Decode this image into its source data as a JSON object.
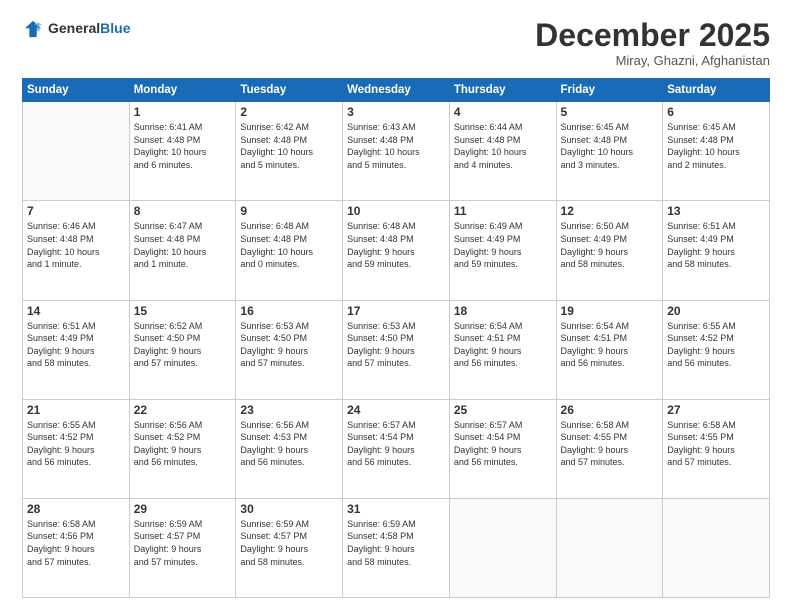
{
  "logo": {
    "general": "General",
    "blue": "Blue"
  },
  "header": {
    "month": "December 2025",
    "location": "Miray, Ghazni, Afghanistan"
  },
  "weekdays": [
    "Sunday",
    "Monday",
    "Tuesday",
    "Wednesday",
    "Thursday",
    "Friday",
    "Saturday"
  ],
  "weeks": [
    [
      {
        "day": "",
        "info": ""
      },
      {
        "day": "1",
        "info": "Sunrise: 6:41 AM\nSunset: 4:48 PM\nDaylight: 10 hours\nand 6 minutes."
      },
      {
        "day": "2",
        "info": "Sunrise: 6:42 AM\nSunset: 4:48 PM\nDaylight: 10 hours\nand 5 minutes."
      },
      {
        "day": "3",
        "info": "Sunrise: 6:43 AM\nSunset: 4:48 PM\nDaylight: 10 hours\nand 5 minutes."
      },
      {
        "day": "4",
        "info": "Sunrise: 6:44 AM\nSunset: 4:48 PM\nDaylight: 10 hours\nand 4 minutes."
      },
      {
        "day": "5",
        "info": "Sunrise: 6:45 AM\nSunset: 4:48 PM\nDaylight: 10 hours\nand 3 minutes."
      },
      {
        "day": "6",
        "info": "Sunrise: 6:45 AM\nSunset: 4:48 PM\nDaylight: 10 hours\nand 2 minutes."
      }
    ],
    [
      {
        "day": "7",
        "info": "Sunrise: 6:46 AM\nSunset: 4:48 PM\nDaylight: 10 hours\nand 1 minute."
      },
      {
        "day": "8",
        "info": "Sunrise: 6:47 AM\nSunset: 4:48 PM\nDaylight: 10 hours\nand 1 minute."
      },
      {
        "day": "9",
        "info": "Sunrise: 6:48 AM\nSunset: 4:48 PM\nDaylight: 10 hours\nand 0 minutes."
      },
      {
        "day": "10",
        "info": "Sunrise: 6:48 AM\nSunset: 4:48 PM\nDaylight: 9 hours\nand 59 minutes."
      },
      {
        "day": "11",
        "info": "Sunrise: 6:49 AM\nSunset: 4:49 PM\nDaylight: 9 hours\nand 59 minutes."
      },
      {
        "day": "12",
        "info": "Sunrise: 6:50 AM\nSunset: 4:49 PM\nDaylight: 9 hours\nand 58 minutes."
      },
      {
        "day": "13",
        "info": "Sunrise: 6:51 AM\nSunset: 4:49 PM\nDaylight: 9 hours\nand 58 minutes."
      }
    ],
    [
      {
        "day": "14",
        "info": "Sunrise: 6:51 AM\nSunset: 4:49 PM\nDaylight: 9 hours\nand 58 minutes."
      },
      {
        "day": "15",
        "info": "Sunrise: 6:52 AM\nSunset: 4:50 PM\nDaylight: 9 hours\nand 57 minutes."
      },
      {
        "day": "16",
        "info": "Sunrise: 6:53 AM\nSunset: 4:50 PM\nDaylight: 9 hours\nand 57 minutes."
      },
      {
        "day": "17",
        "info": "Sunrise: 6:53 AM\nSunset: 4:50 PM\nDaylight: 9 hours\nand 57 minutes."
      },
      {
        "day": "18",
        "info": "Sunrise: 6:54 AM\nSunset: 4:51 PM\nDaylight: 9 hours\nand 56 minutes."
      },
      {
        "day": "19",
        "info": "Sunrise: 6:54 AM\nSunset: 4:51 PM\nDaylight: 9 hours\nand 56 minutes."
      },
      {
        "day": "20",
        "info": "Sunrise: 6:55 AM\nSunset: 4:52 PM\nDaylight: 9 hours\nand 56 minutes."
      }
    ],
    [
      {
        "day": "21",
        "info": "Sunrise: 6:55 AM\nSunset: 4:52 PM\nDaylight: 9 hours\nand 56 minutes."
      },
      {
        "day": "22",
        "info": "Sunrise: 6:56 AM\nSunset: 4:52 PM\nDaylight: 9 hours\nand 56 minutes."
      },
      {
        "day": "23",
        "info": "Sunrise: 6:56 AM\nSunset: 4:53 PM\nDaylight: 9 hours\nand 56 minutes."
      },
      {
        "day": "24",
        "info": "Sunrise: 6:57 AM\nSunset: 4:54 PM\nDaylight: 9 hours\nand 56 minutes."
      },
      {
        "day": "25",
        "info": "Sunrise: 6:57 AM\nSunset: 4:54 PM\nDaylight: 9 hours\nand 56 minutes."
      },
      {
        "day": "26",
        "info": "Sunrise: 6:58 AM\nSunset: 4:55 PM\nDaylight: 9 hours\nand 57 minutes."
      },
      {
        "day": "27",
        "info": "Sunrise: 6:58 AM\nSunset: 4:55 PM\nDaylight: 9 hours\nand 57 minutes."
      }
    ],
    [
      {
        "day": "28",
        "info": "Sunrise: 6:58 AM\nSunset: 4:56 PM\nDaylight: 9 hours\nand 57 minutes."
      },
      {
        "day": "29",
        "info": "Sunrise: 6:59 AM\nSunset: 4:57 PM\nDaylight: 9 hours\nand 57 minutes."
      },
      {
        "day": "30",
        "info": "Sunrise: 6:59 AM\nSunset: 4:57 PM\nDaylight: 9 hours\nand 58 minutes."
      },
      {
        "day": "31",
        "info": "Sunrise: 6:59 AM\nSunset: 4:58 PM\nDaylight: 9 hours\nand 58 minutes."
      },
      {
        "day": "",
        "info": ""
      },
      {
        "day": "",
        "info": ""
      },
      {
        "day": "",
        "info": ""
      }
    ]
  ]
}
